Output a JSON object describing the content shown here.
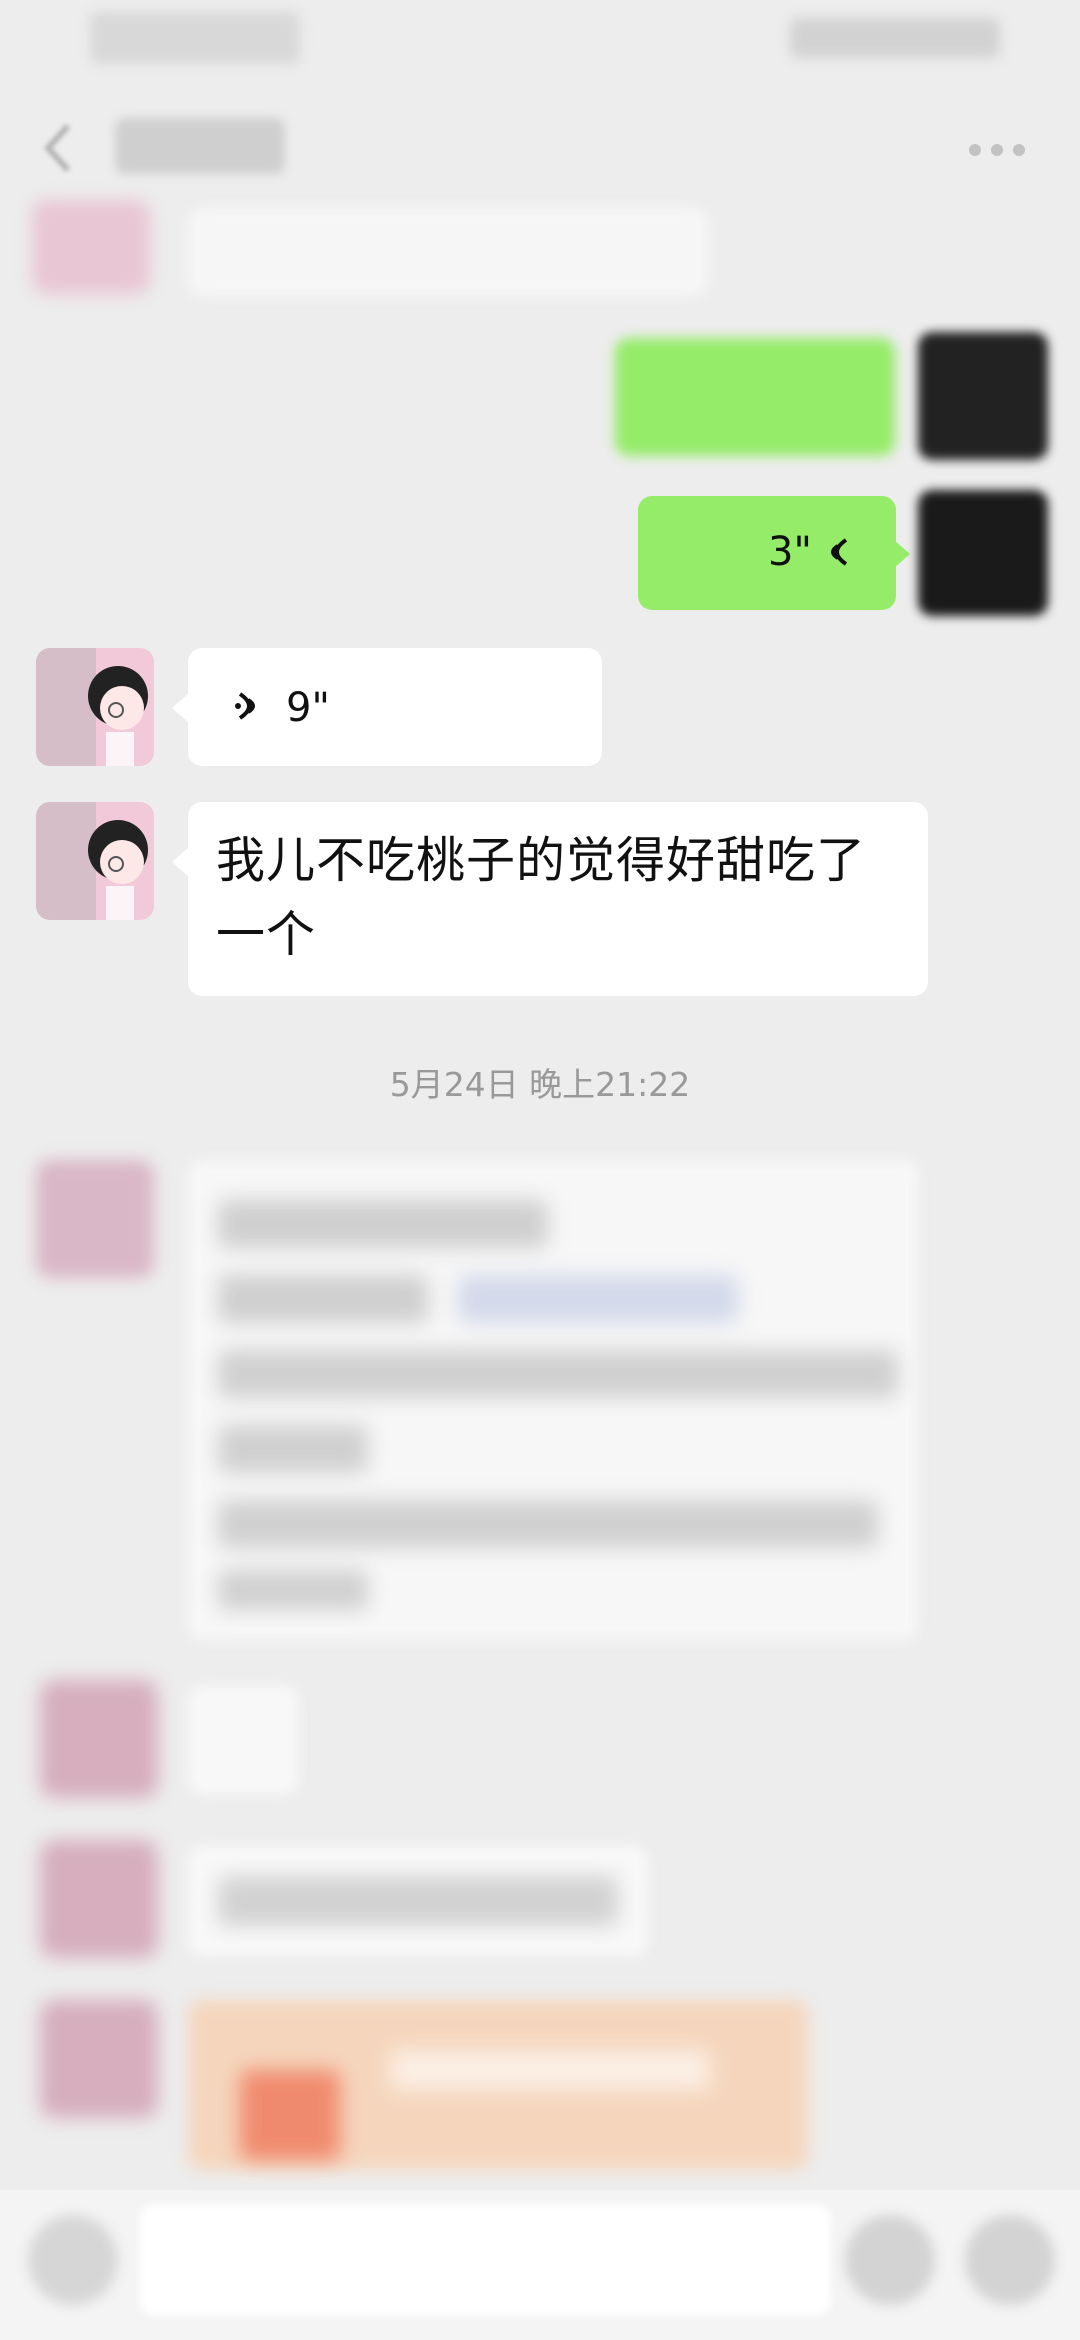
{
  "chat": {
    "voice_in_duration": "9\"",
    "voice_out_duration": "3\"",
    "text_in_message": "我儿不吃桃子的觉得好甜吃了一个",
    "timestamp": "5月24日 晚上21:22"
  },
  "icons": {
    "back": "back-arrow-icon",
    "more": "more-dots-icon",
    "voice": "voice-wave-icon",
    "emoji": "emoji-icon",
    "plus": "plus-icon"
  },
  "colors": {
    "chat_background": "#ededed",
    "incoming_bubble": "#ffffff",
    "outgoing_bubble": "#95ec69",
    "timestamp_text": "#999999"
  }
}
